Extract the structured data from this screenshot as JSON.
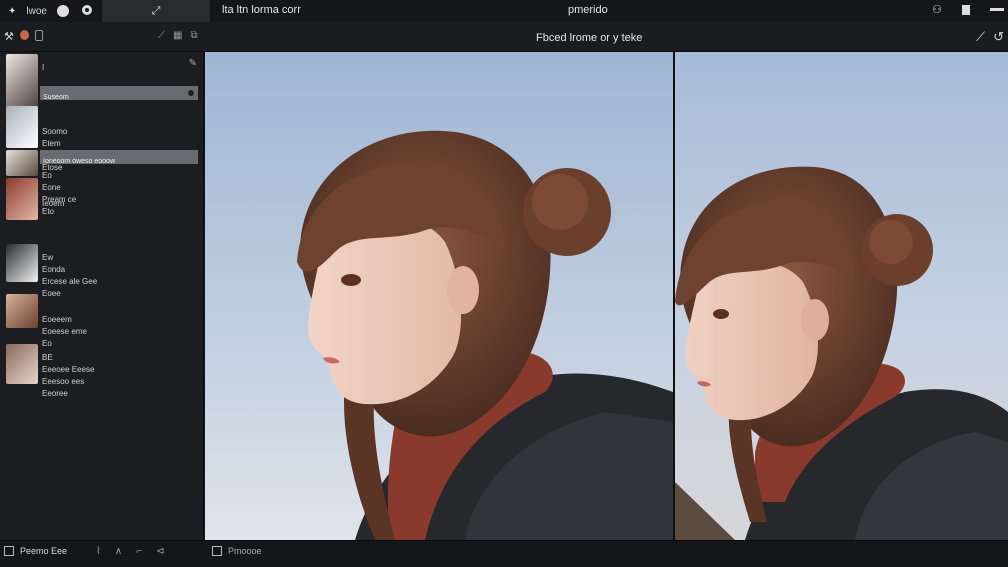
{
  "topbar": {
    "left_label": "lwoe",
    "menu_text": "lta ltn lorma corr",
    "app_title": "pmerido"
  },
  "toolbar2": {
    "document_title": "Fbced lrome or y teke"
  },
  "sidebar": {
    "layers": [
      {
        "lines": [
          "I",
          "",
          "",
          "",
          ""
        ],
        "selected": ""
      },
      {
        "lines": [
          "",
          "Soomo",
          "Etem",
          "Eod  sne",
          "Etose"
        ],
        "selected": "Suseom"
      },
      {
        "lines": [
          "",
          "Eo",
          "Eone",
          "Pream ce",
          "Eto"
        ],
        "selected": ""
      },
      {
        "lines": [
          "",
          "Ieoem",
          "",
          "",
          ""
        ],
        "selected": "Ioneoom oweso eooow"
      },
      {
        "lines": [
          "Ew",
          "Eonda",
          "Ercese ale Gee",
          "Eoee"
        ],
        "selected": ""
      },
      {
        "lines": [
          "",
          "Eoeeem",
          "Eoeese eme",
          "Eo"
        ],
        "selected": ""
      },
      {
        "lines": [
          "BE",
          "Eeeoee Eeese",
          "Eeesoo ees",
          "Eeoree"
        ],
        "selected": ""
      }
    ]
  },
  "statusbar": {
    "left_label": "Peemo Eee",
    "mid_label": "Pmoooe"
  },
  "colors": {
    "sky": "#b4c6dc",
    "hair": "#6e4230",
    "jacket": "#2a2c30",
    "scarf": "#8a3a2c"
  }
}
